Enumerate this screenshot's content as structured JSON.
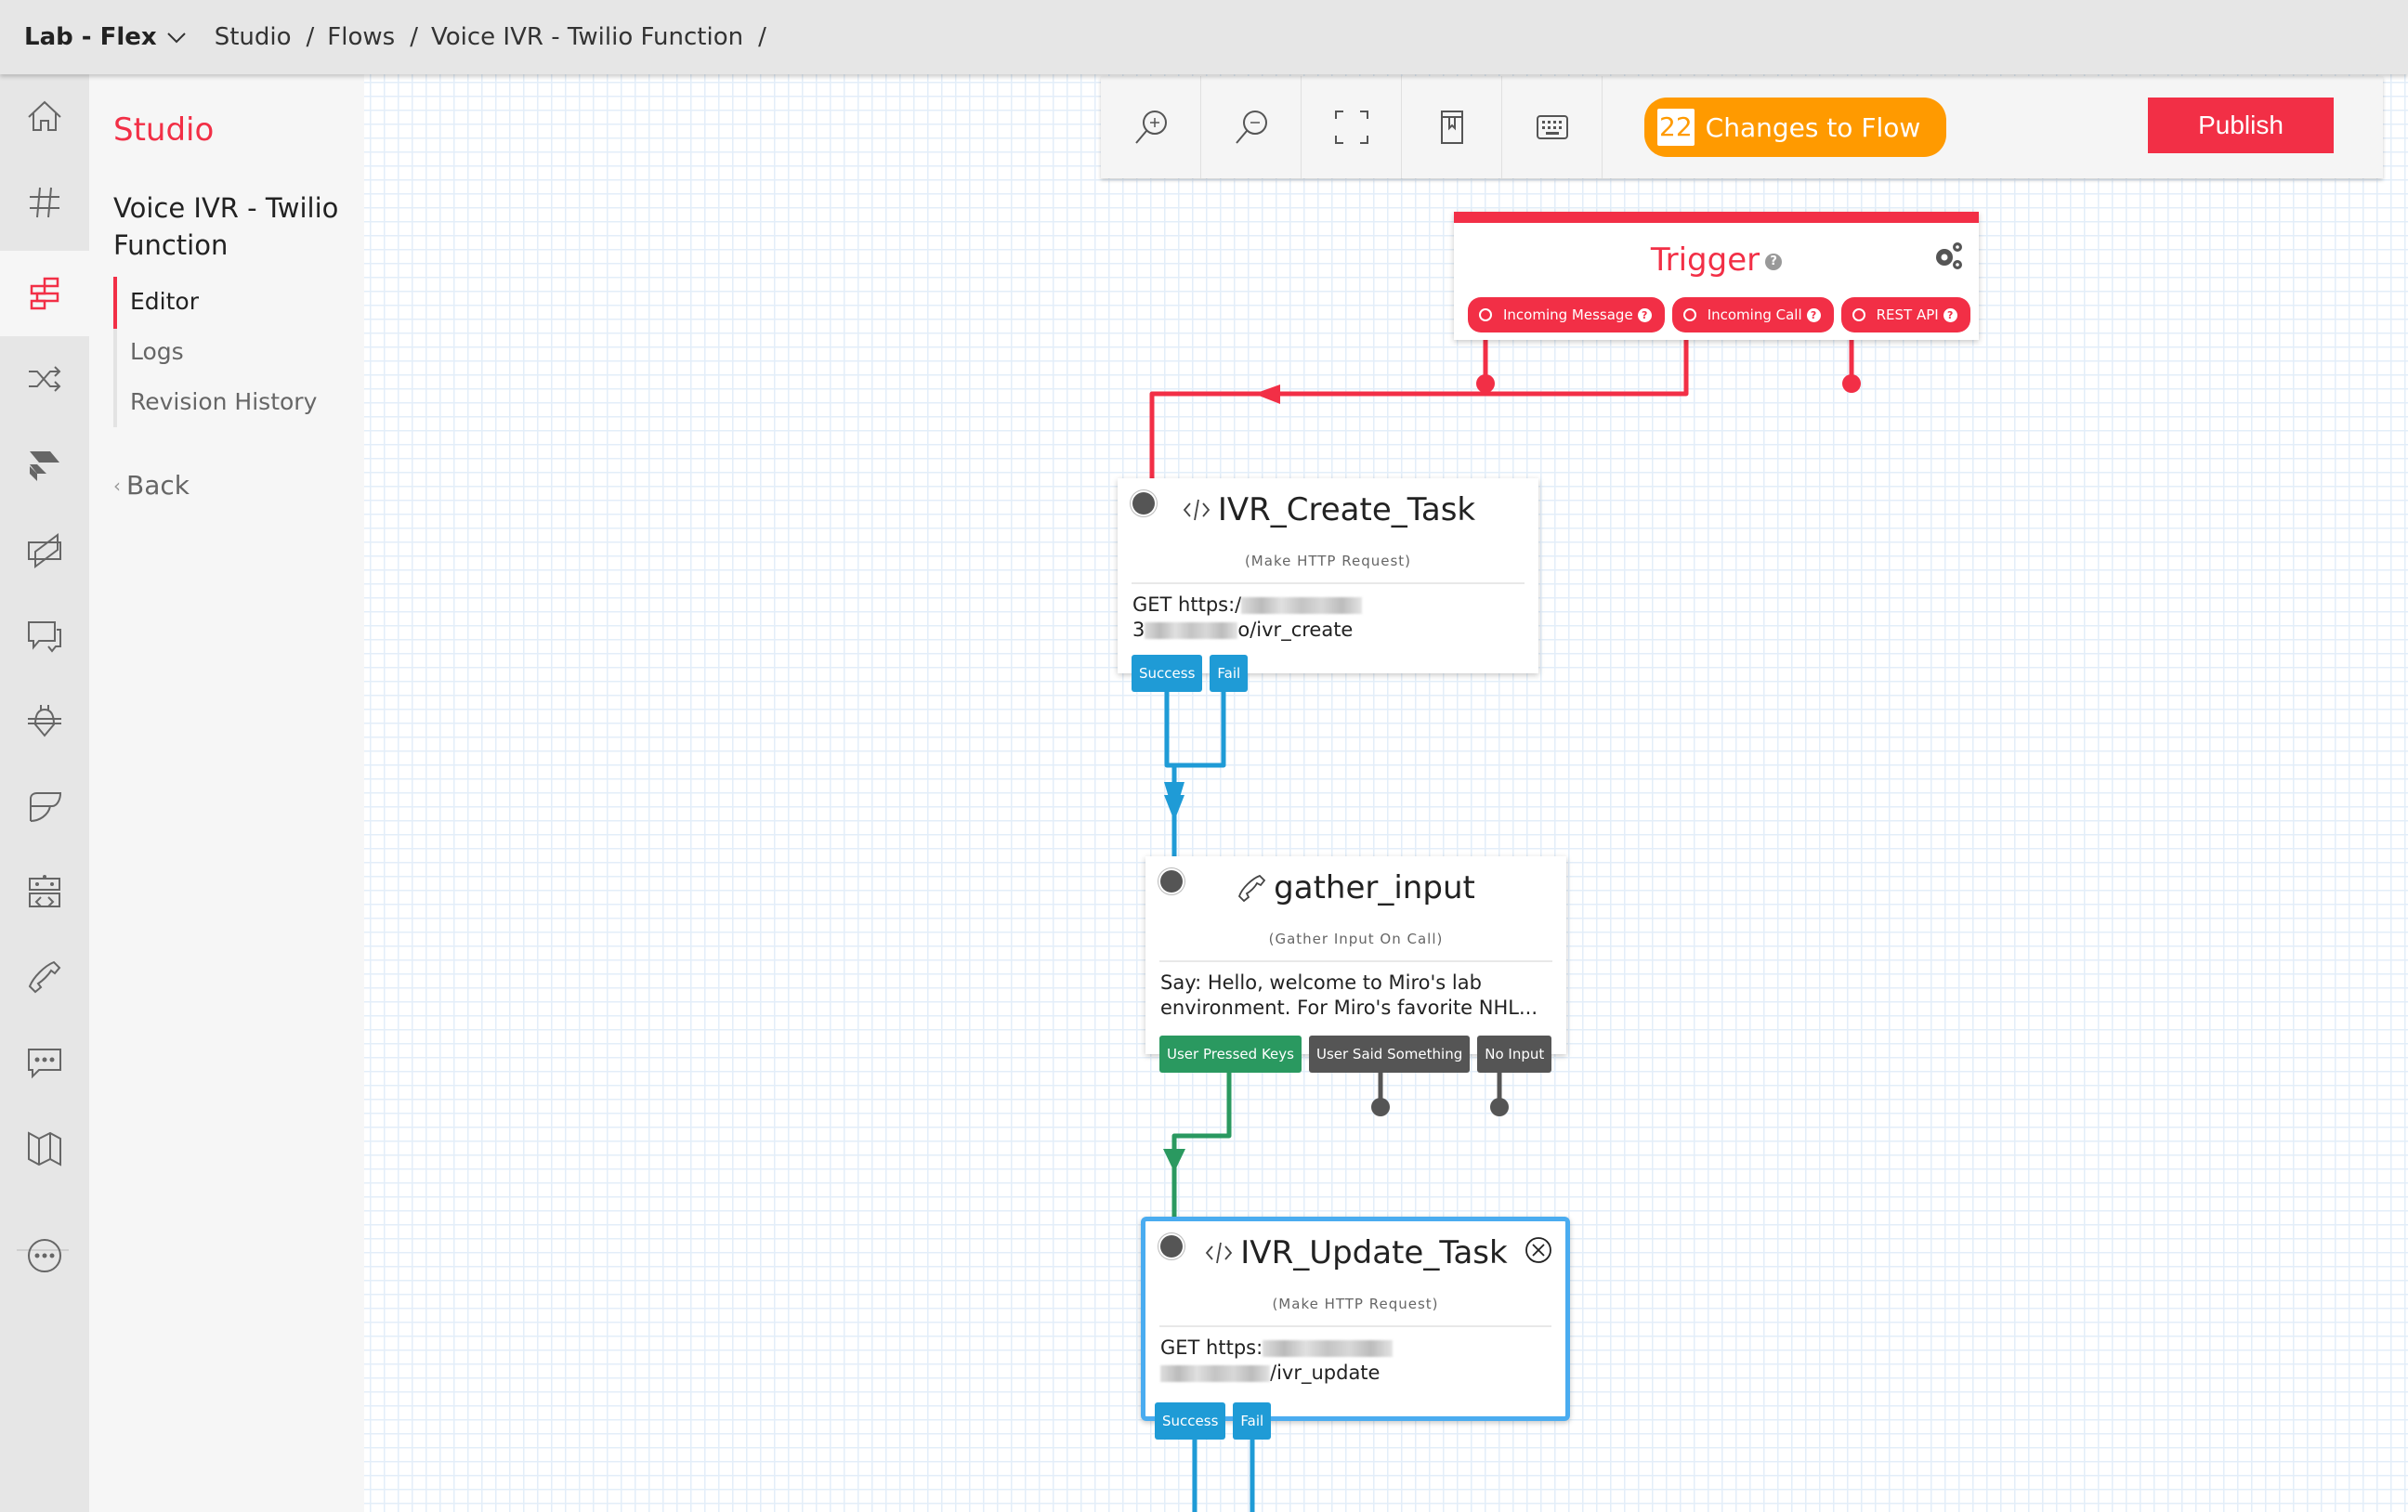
{
  "topbar": {
    "account": "Lab - Flex",
    "breadcrumbs": [
      "Studio",
      "Flows",
      "Voice IVR - Twilio Function"
    ],
    "separator": "/"
  },
  "rail": {
    "items": [
      {
        "icon": "home-icon"
      },
      {
        "icon": "hash-icon"
      },
      {
        "icon": "studio-icon",
        "active": true
      },
      {
        "icon": "shuffle-icon"
      },
      {
        "icon": "flex-icon"
      },
      {
        "icon": "video-icon"
      },
      {
        "icon": "chat-icon"
      },
      {
        "icon": "bug-icon"
      },
      {
        "icon": "wing-icon"
      },
      {
        "icon": "robot-icon"
      },
      {
        "icon": "phone-icon"
      },
      {
        "icon": "sms-icon"
      },
      {
        "icon": "map-icon"
      },
      {
        "icon": "more-icon"
      }
    ]
  },
  "subnav": {
    "title": "Studio",
    "flow_name": "Voice IVR - Twilio Function",
    "menu": [
      {
        "label": "Editor",
        "active": true
      },
      {
        "label": "Logs"
      },
      {
        "label": "Revision History"
      }
    ],
    "back": "Back",
    "back_glyph": "‹"
  },
  "toolbar": {
    "buttons": [
      "zoom-in",
      "zoom-out",
      "fit-to-screen",
      "bookmark",
      "keyboard-shortcuts"
    ],
    "changes_count": "22",
    "changes_label": "Changes to Flow",
    "publish_label": "Publish"
  },
  "colors": {
    "brand_red": "#f22f46",
    "changes_orange": "#ff9a00",
    "transition_blue": "#1f9bd6",
    "transition_green": "#2a9960",
    "transition_gray": "#555555",
    "selected_border": "#4aacf0"
  },
  "flow": {
    "trigger": {
      "title": "Trigger",
      "help": "?",
      "buttons": [
        "Incoming Message",
        "Incoming Call",
        "REST API"
      ]
    },
    "widgets": [
      {
        "name": "IVR_Create_Task",
        "type": "(Make HTTP Request)",
        "icon": "code-icon",
        "line1": "GET https:/",
        "line2_prefix": "3",
        "line2_suffix": "o/ivr_create",
        "transitions": [
          "Success",
          "Fail"
        ]
      },
      {
        "name": "gather_input",
        "type": "(Gather Input On Call)",
        "icon": "phone-icon",
        "line1": "Say: Hello, welcome to Miro's lab",
        "line2": "environment. For Miro's favorite NHL...",
        "transitions": [
          "User Pressed Keys",
          "User Said Something",
          "No Input"
        ]
      },
      {
        "name": "IVR_Update_Task",
        "type": "(Make HTTP Request)",
        "icon": "code-icon",
        "line1": "GET https:",
        "line2_suffix": "/ivr_update",
        "transitions": [
          "Success",
          "Fail"
        ],
        "selected": true
      }
    ]
  }
}
